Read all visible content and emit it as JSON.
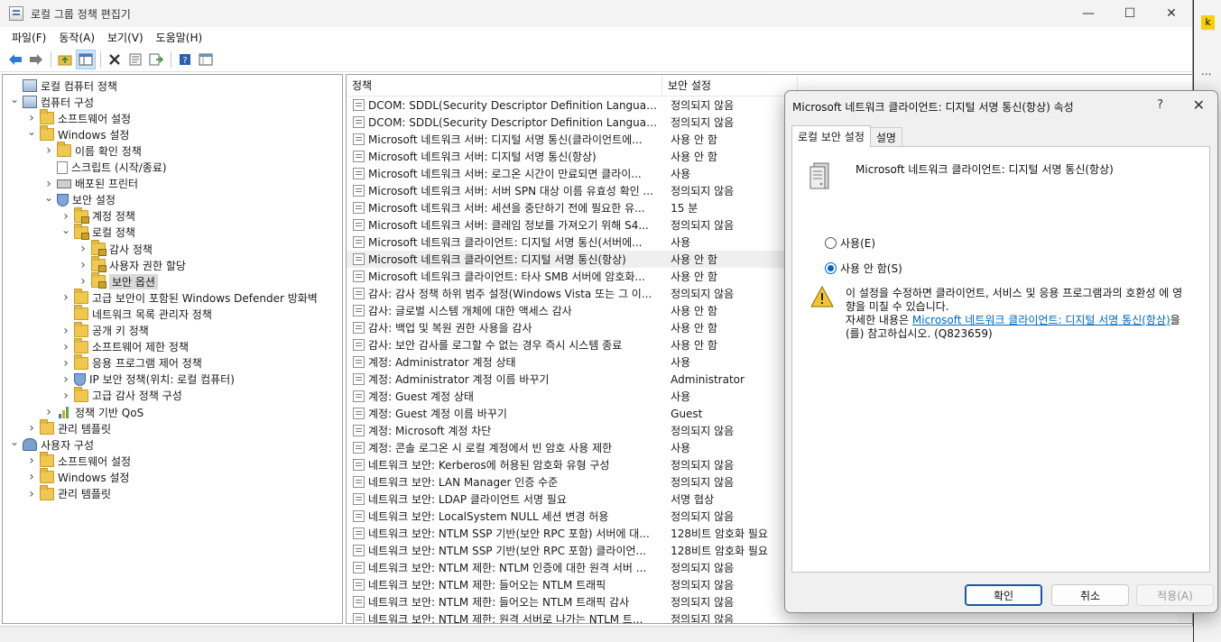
{
  "window": {
    "title": "로컬 그룹 정책 편집기",
    "controls": {
      "minimize": "—",
      "maximize": "☐",
      "close": "✕"
    }
  },
  "menu": [
    "파일(F)",
    "동작(A)",
    "보기(V)",
    "도움말(H)"
  ],
  "tree": [
    {
      "label": "로컬 컴퓨터 정책",
      "level": 0,
      "chevron": "",
      "icon": "computer"
    },
    {
      "label": "컴퓨터 구성",
      "level": 0,
      "chevron": "v",
      "icon": "computer"
    },
    {
      "label": "소프트웨어 설정",
      "level": 1,
      "chevron": ">",
      "icon": "folder"
    },
    {
      "label": "Windows 설정",
      "level": 1,
      "chevron": "v",
      "icon": "folder"
    },
    {
      "label": "이름 확인 정책",
      "level": 2,
      "chevron": ">",
      "icon": "folder"
    },
    {
      "label": "스크립트 (시작/종료)",
      "level": 2,
      "chevron": "",
      "icon": "doc"
    },
    {
      "label": "배포된 프린터",
      "level": 2,
      "chevron": ">",
      "icon": "printer"
    },
    {
      "label": "보안 설정",
      "level": 2,
      "chevron": "v",
      "icon": "shield"
    },
    {
      "label": "계정 정책",
      "level": 3,
      "chevron": ">",
      "icon": "lockfolder"
    },
    {
      "label": "로컬 정책",
      "level": 3,
      "chevron": "v",
      "icon": "lockfolder"
    },
    {
      "label": "감사 정책",
      "level": 4,
      "chevron": ">",
      "icon": "lockfolder"
    },
    {
      "label": "사용자 권한 할당",
      "level": 4,
      "chevron": ">",
      "icon": "lockfolder"
    },
    {
      "label": "보안 옵션",
      "level": 4,
      "chevron": ">",
      "icon": "lockfolder",
      "selected": true
    },
    {
      "label": "고급 보안이 포함된 Windows Defender 방화벽",
      "level": 3,
      "chevron": ">",
      "icon": "folder"
    },
    {
      "label": "네트워크 목록 관리자 정책",
      "level": 3,
      "chevron": "",
      "icon": "folder"
    },
    {
      "label": "공개 키 정책",
      "level": 3,
      "chevron": ">",
      "icon": "folder"
    },
    {
      "label": "소프트웨어 제한 정책",
      "level": 3,
      "chevron": ">",
      "icon": "folder"
    },
    {
      "label": "응용 프로그램 제어 정책",
      "level": 3,
      "chevron": ">",
      "icon": "folder"
    },
    {
      "label": "IP 보안 정책(위치: 로컬 컴퓨터)",
      "level": 3,
      "chevron": ">",
      "icon": "shield"
    },
    {
      "label": "고급 감사 정책 구성",
      "level": 3,
      "chevron": ">",
      "icon": "folder"
    },
    {
      "label": "정책 기반 QoS",
      "level": 2,
      "chevron": ">",
      "icon": "chart"
    },
    {
      "label": "관리 템플릿",
      "level": 1,
      "chevron": ">",
      "icon": "folder"
    },
    {
      "label": "사용자 구성",
      "level": 0,
      "chevron": "v",
      "icon": "people"
    },
    {
      "label": "소프트웨어 설정",
      "level": 1,
      "chevron": ">",
      "icon": "folder"
    },
    {
      "label": "Windows 설정",
      "level": 1,
      "chevron": ">",
      "icon": "folder"
    },
    {
      "label": "관리 템플릿",
      "level": 1,
      "chevron": ">",
      "icon": "folder"
    }
  ],
  "list": {
    "columns": {
      "policy": "정책",
      "setting": "보안 설정"
    },
    "rows": [
      {
        "policy": "DCOM: SDDL(Security Descriptor Definition Language) 구...",
        "setting": "정의되지 않음"
      },
      {
        "policy": "DCOM: SDDL(Security Descriptor Definition Language) 구...",
        "setting": "정의되지 않음"
      },
      {
        "policy": "Microsoft 네트워크 서버: 디지털 서명 통신(클라이언트에...",
        "setting": "사용 안 함"
      },
      {
        "policy": "Microsoft 네트워크 서버: 디지털 서명 통신(항상)",
        "setting": "사용 안 함"
      },
      {
        "policy": "Microsoft 네트워크 서버: 로그온 시간이 만료되면 클라이...",
        "setting": "사용"
      },
      {
        "policy": "Microsoft 네트워크 서버: 서버 SPN 대상 이름 유효성 확인 ...",
        "setting": "정의되지 않음"
      },
      {
        "policy": "Microsoft 네트워크 서버: 세션을 중단하기 전에 필요한 유...",
        "setting": "15 분"
      },
      {
        "policy": "Microsoft 네트워크 서버: 클레임 정보를 가져오기 위해 S4...",
        "setting": "정의되지 않음"
      },
      {
        "policy": "Microsoft 네트워크 클라이언트: 디지털 서명 통신(서버에...",
        "setting": "사용"
      },
      {
        "policy": "Microsoft 네트워크 클라이언트: 디지털 서명 통신(항상)",
        "setting": "사용 안 함",
        "highlight": true
      },
      {
        "policy": "Microsoft 네트워크 클라이언트: 타사 SMB 서버에 암호화...",
        "setting": "사용 안 함"
      },
      {
        "policy": "감사: 감사 정책 하위 범주 설정(Windows Vista 또는 그 이...",
        "setting": "정의되지 않음"
      },
      {
        "policy": "감사: 글로벌 시스템 개체에 대한 액세스 감사",
        "setting": "사용 안 함"
      },
      {
        "policy": "감사: 백업 및 복원 권한 사용을 감사",
        "setting": "사용 안 함"
      },
      {
        "policy": "감사: 보안 감사를 로그할 수 없는 경우 즉시 시스템 종료",
        "setting": "사용 안 함"
      },
      {
        "policy": "계정: Administrator 계정 상태",
        "setting": "사용"
      },
      {
        "policy": "계정: Administrator 계정 이름 바꾸기",
        "setting": "Administrator"
      },
      {
        "policy": "계정: Guest 계정 상태",
        "setting": "사용"
      },
      {
        "policy": "계정: Guest 계정 이름 바꾸기",
        "setting": "Guest"
      },
      {
        "policy": "계정: Microsoft 계정 차단",
        "setting": "정의되지 않음"
      },
      {
        "policy": "계정: 콘솔 로그온 시 로컬 계정에서 빈 암호 사용 제한",
        "setting": "사용"
      },
      {
        "policy": "네트워크 보안: Kerberos에 허용된 암호화 유형 구성",
        "setting": "정의되지 않음"
      },
      {
        "policy": "네트워크 보안: LAN Manager 인증 수준",
        "setting": "정의되지 않음"
      },
      {
        "policy": "네트워크 보안: LDAP 클라이언트 서명 필요",
        "setting": "서명 협상"
      },
      {
        "policy": "네트워크 보안: LocalSystem NULL 세션 변경 허용",
        "setting": "정의되지 않음"
      },
      {
        "policy": "네트워크 보안: NTLM SSP 기반(보안 RPC 포함) 서버에 대...",
        "setting": "128비트 암호화 필요"
      },
      {
        "policy": "네트워크 보안: NTLM SSP 기반(보안 RPC 포함) 클라이언...",
        "setting": "128비트 암호화 필요"
      },
      {
        "policy": "네트워크 보안: NTLM 제한: NTLM 인증에 대한 원격 서버 ...",
        "setting": "정의되지 않음"
      },
      {
        "policy": "네트워크 보안: NTLM 제한: 들어오는 NTLM 트래픽",
        "setting": "정의되지 않음"
      },
      {
        "policy": "네트워크 보안: NTLM 제한: 들어오는 NTLM 트래픽 감사",
        "setting": "정의되지 않음"
      },
      {
        "policy": "네트워크 보안: NTLM 제한: 원격 서버로 나가는 NTLM 트...",
        "setting": "정의되지 않음"
      }
    ]
  },
  "side": {
    "badge": "k",
    "dots": "..."
  },
  "dialog": {
    "title": "Microsoft 네트워크 클라이언트: 디지털 서명 통신(항상) 속성",
    "help": "?",
    "close": "✕",
    "tabs": [
      "로컬 보안 설정",
      "설명"
    ],
    "heading": "Microsoft 네트워크 클라이언트: 디지털 서명 통신(항상)",
    "options": [
      {
        "label": "사용(E)",
        "checked": false
      },
      {
        "label": "사용 안 함(S)",
        "checked": true
      }
    ],
    "warning": {
      "line1": "이 설정을 수정하면 클라이언트, 서비스 및 응용 프로그램과의 호환성 에 영향을 미칠 수 있습니다.",
      "more_prefix": "자세한 내용은 ",
      "link": "Microsoft 네트워크 클라이언트: 디지털 서명 통신(항상)",
      "more_suffix": "을(를) 참고하십시오. (Q823659)"
    },
    "buttons": {
      "ok": "확인",
      "cancel": "취소",
      "apply": "적용(A)"
    }
  }
}
